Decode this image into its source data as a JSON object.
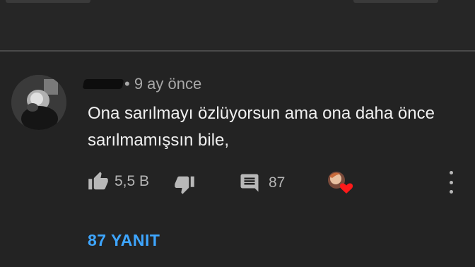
{
  "comment": {
    "author_redacted": true,
    "timestamp": "9 ay önce",
    "text": "Ona sarılmayı özlüyorsun ama ona daha önce sarılmamışsın bile,",
    "like_count": "5,5 B",
    "reply_count": "87",
    "creator_heart": true
  },
  "replies_link": "87 YANIT",
  "icons": {
    "like": "thumbs-up-icon",
    "dislike": "thumbs-down-icon",
    "reply": "comment-icon",
    "creator_heart": "creator-heart-icon",
    "more": "more-vert-icon"
  },
  "colors": {
    "background": "#232323",
    "link": "#3ea6ff",
    "heart": "#ff0000",
    "meta": "#a8a8a8"
  }
}
